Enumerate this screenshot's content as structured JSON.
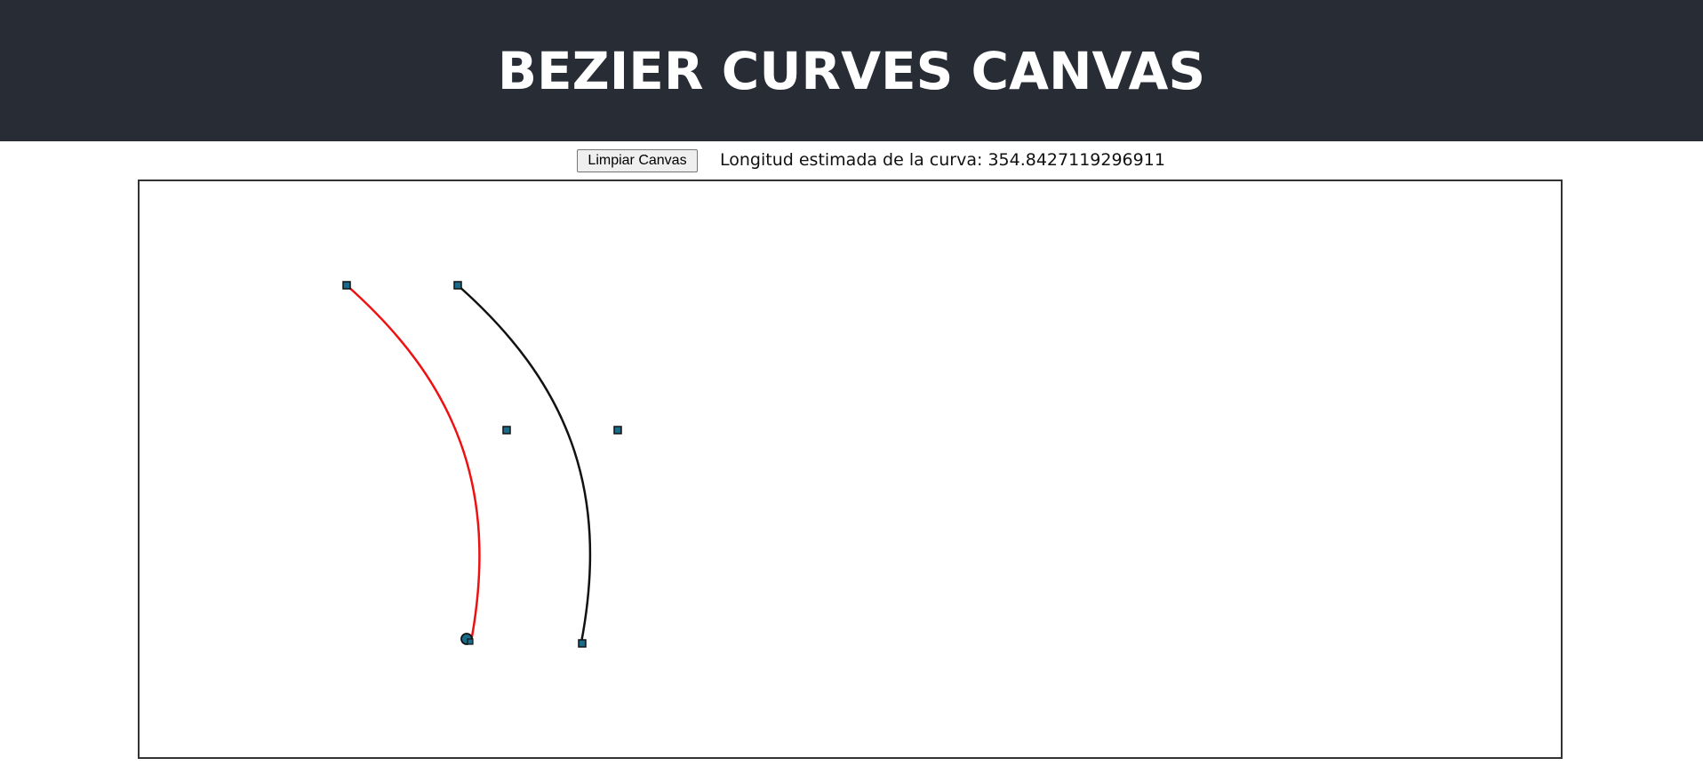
{
  "header": {
    "title": "BEZIER CURVES CANVAS"
  },
  "toolbar": {
    "clear_label": "Limpiar Canvas",
    "length_label": "Longitud estimada de la curva: ",
    "length_value": "354.8427119296911"
  },
  "canvas": {
    "curve_colors": {
      "selected": "#ee1111",
      "other": "#111111"
    },
    "handle_color": "#1a6b8a"
  }
}
